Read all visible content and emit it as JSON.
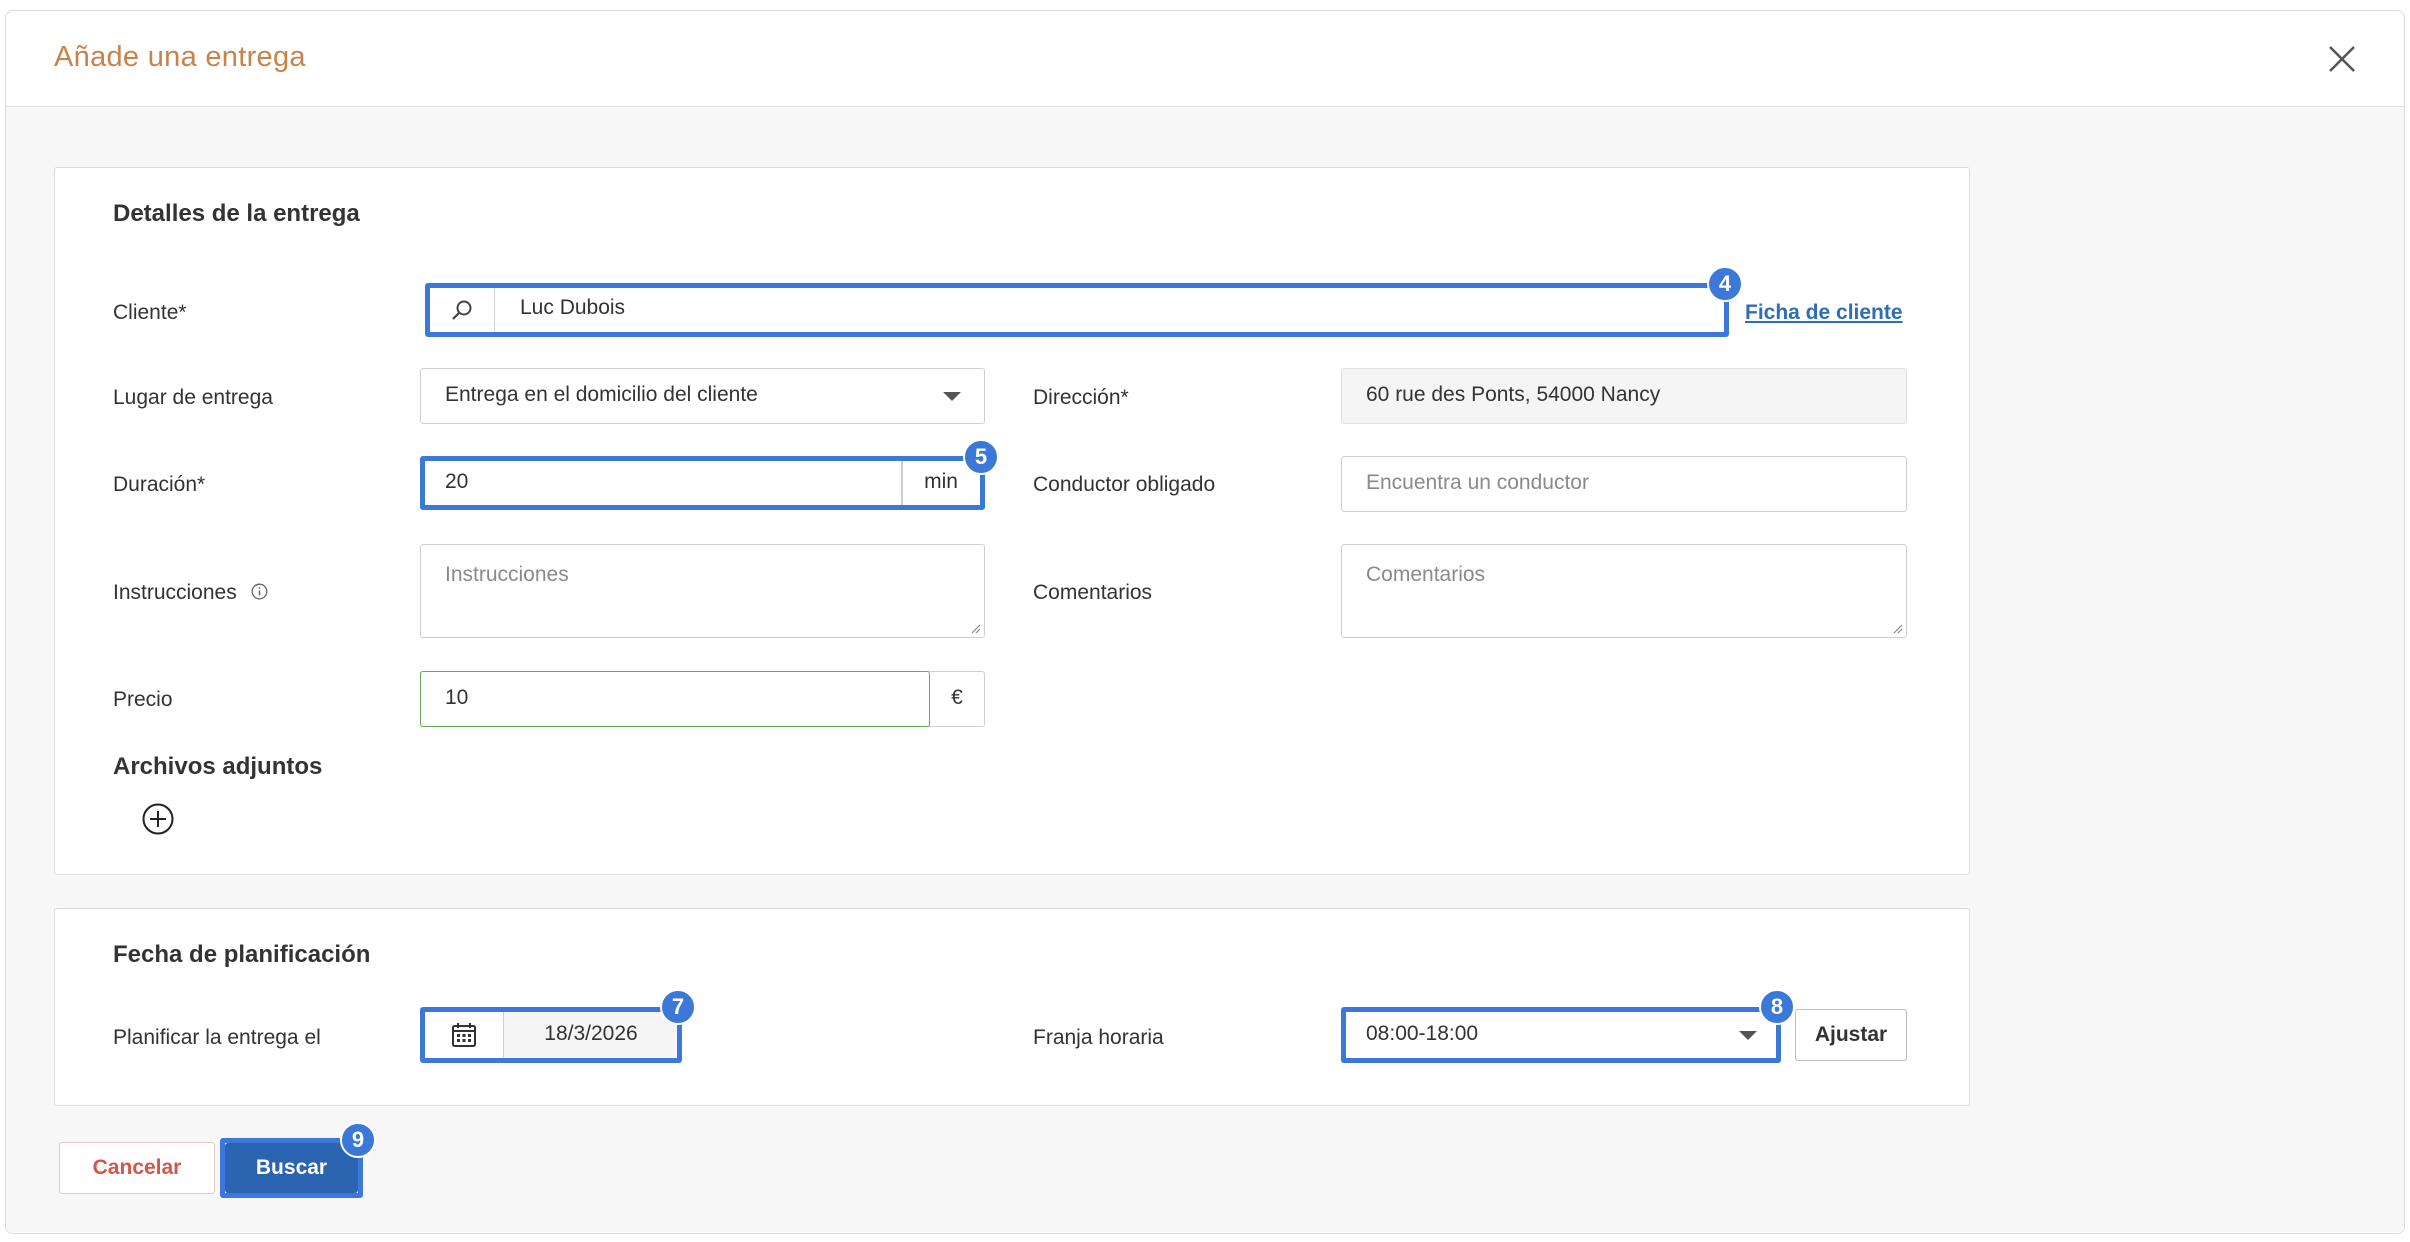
{
  "modal": {
    "title": "Añade una entrega"
  },
  "details": {
    "section_title": "Detalles de la entrega",
    "client_label": "Cliente*",
    "client_value": "Luc Dubois",
    "client_link": "Ficha de cliente",
    "location_label": "Lugar de entrega",
    "location_value": "Entrega en el domicilio del cliente",
    "address_label": "Dirección*",
    "address_value": "60 rue des Ponts, 54000 Nancy",
    "duration_label": "Duración*",
    "duration_value": "20",
    "duration_unit": "min",
    "driver_label": "Conductor obligado",
    "driver_placeholder": "Encuentra un conductor",
    "instructions_label": "Instrucciones",
    "instructions_placeholder": "Instrucciones",
    "comments_label": "Comentarios",
    "comments_placeholder": "Comentarios",
    "price_label": "Precio",
    "price_value": "10",
    "price_unit": "€",
    "attachments_title": "Archivos adjuntos"
  },
  "planning": {
    "section_title": "Fecha de planificación",
    "date_label": "Planificar la entrega el",
    "date_value": "18/3/2026",
    "slot_label": "Franja horaria",
    "slot_value": "08:00-18:00",
    "adjust_label": "Ajustar"
  },
  "footer": {
    "cancel_label": "Cancelar",
    "search_label": "Buscar"
  },
  "badges": {
    "client": "4",
    "duration": "5",
    "date": "7",
    "slot": "8",
    "search": "9"
  },
  "colors": {
    "title": "#c8834b",
    "highlight": "#3b78d8",
    "link": "#2f6db5",
    "cancel": "#d0574a",
    "primary": "#2b65b1",
    "price_border": "#6aa65a"
  }
}
